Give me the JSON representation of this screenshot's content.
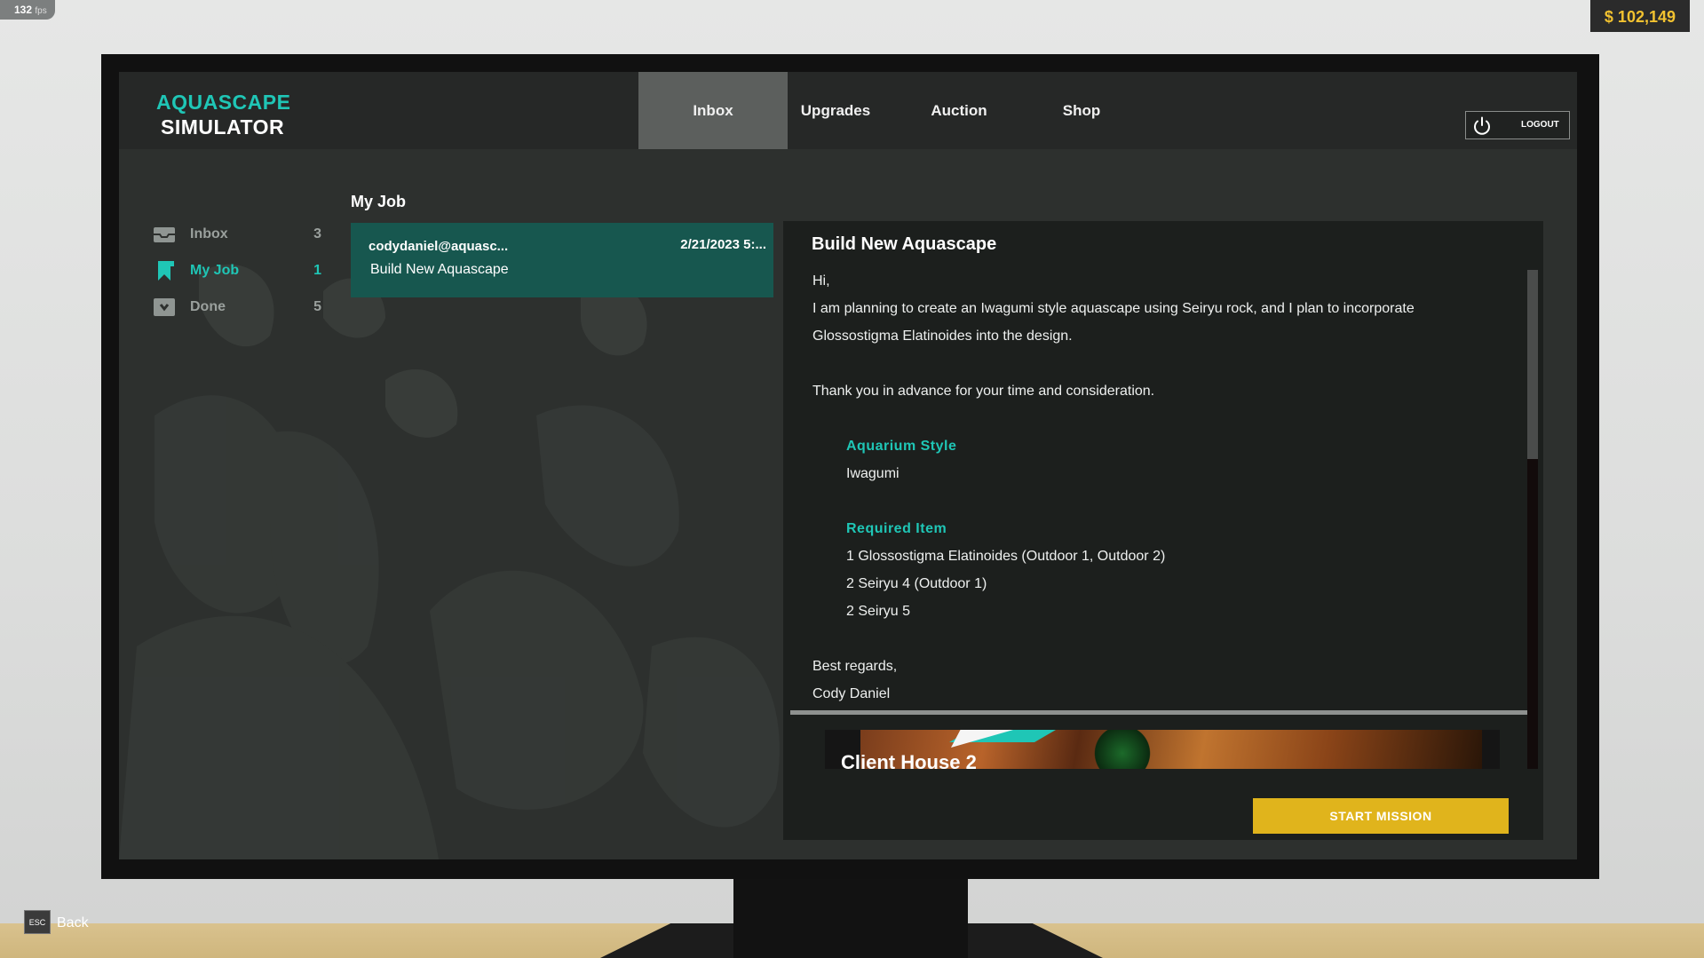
{
  "hud": {
    "fps_value": "132",
    "fps_unit": "fps",
    "money": "$ 102,149",
    "esc_key": "ESC",
    "back_label": "Back"
  },
  "logo": {
    "line1": "AQUASCAPE",
    "line2": "SIMULATOR"
  },
  "tabs": [
    {
      "label": "Inbox",
      "active": true
    },
    {
      "label": "Upgrades"
    },
    {
      "label": "Auction"
    },
    {
      "label": "Shop"
    }
  ],
  "logout": {
    "label": "LOGOUT",
    "icon": "power-icon"
  },
  "sidebar": {
    "items": [
      {
        "label": "Inbox",
        "count": "3",
        "icon": "inbox-tray-icon"
      },
      {
        "label": "My Job",
        "count": "1",
        "icon": "bookmark-icon",
        "active": true
      },
      {
        "label": "Done",
        "count": "5",
        "icon": "archive-box-icon"
      }
    ]
  },
  "list": {
    "title": "My Job",
    "items": [
      {
        "from": "codydaniel@aquasc...",
        "date": "2/21/2023 5:...",
        "subject": "Build New Aquascape"
      }
    ]
  },
  "detail": {
    "title": "Build New Aquascape",
    "greeting": "Hi,",
    "para1_line1": "I am planning to create an Iwagumi style aquascape using Seiryu rock, and I plan to incorporate",
    "para1_line2": "Glossostigma Elatinoides into the design.",
    "para2": "Thank you in advance for your time and consideration.",
    "style_heading": "Aquarium Style",
    "style_value": "Iwagumi",
    "required_heading": "Required Item",
    "required_items": [
      "1 Glossostigma Elatinoides (Outdoor 1, Outdoor 2)",
      "2 Seiryu 4 (Outdoor 1)",
      "2 Seiryu 5"
    ],
    "closing": "Best regards,",
    "signature": "Cody Daniel",
    "preview_title": "Client House 2",
    "start_button": "START MISSION"
  },
  "colors": {
    "accent": "#1fc6b6",
    "money": "#f2c230",
    "start_button": "#e0b41c",
    "selected_mail": "#17574f"
  }
}
